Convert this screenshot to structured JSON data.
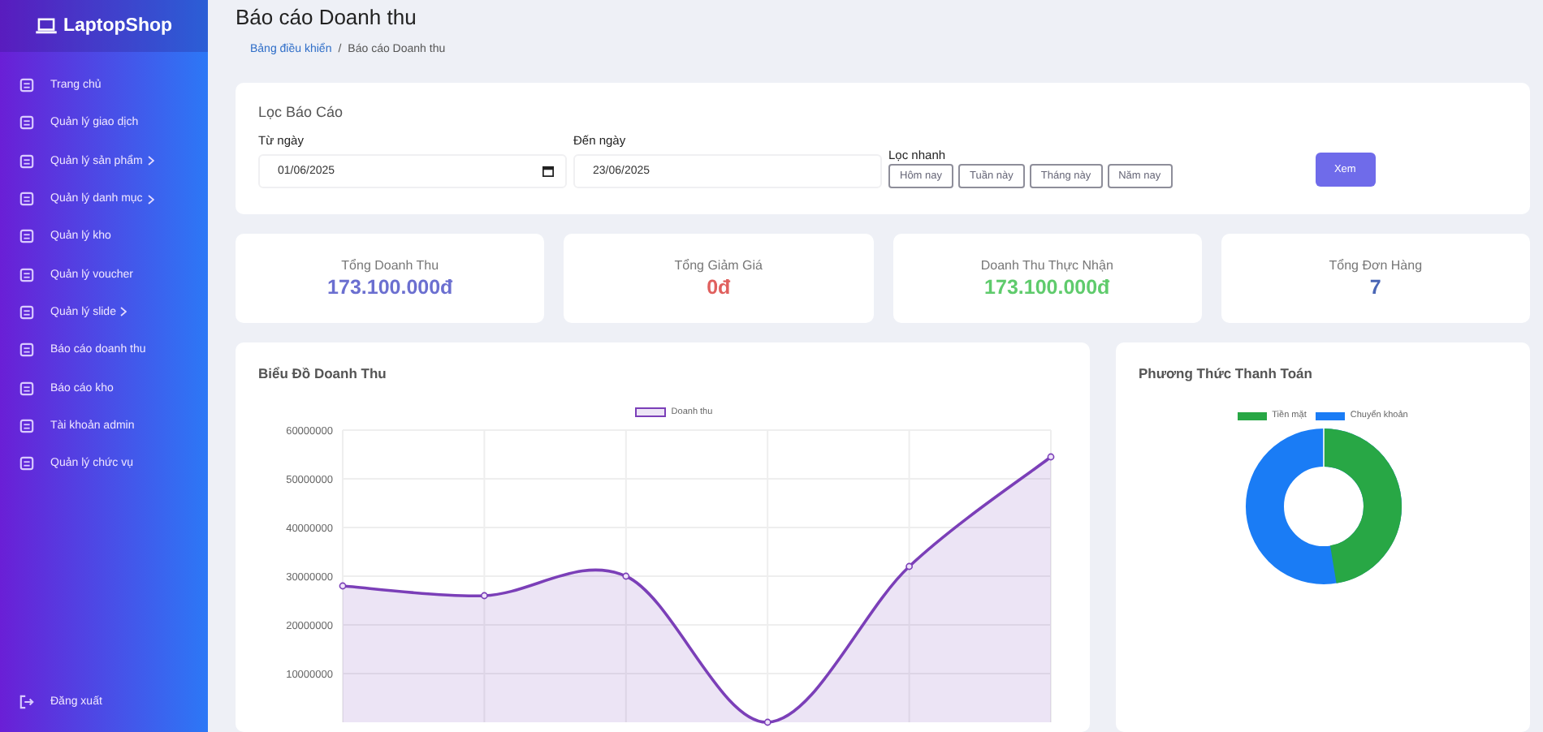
{
  "sidebar": {
    "logo": "LaptopShop",
    "items": [
      {
        "label": "Trang chủ",
        "expandable": false
      },
      {
        "label": "Quản lý giao dịch",
        "expandable": false
      },
      {
        "label": "Quản lý sản phẩm",
        "expandable": true
      },
      {
        "label": "Quản lý danh mục",
        "expandable": true
      },
      {
        "label": "Quản lý kho",
        "expandable": false
      },
      {
        "label": "Quản lý voucher",
        "expandable": false
      },
      {
        "label": "Quản lý slide",
        "expandable": true
      },
      {
        "label": "Báo cáo doanh thu",
        "expandable": false
      },
      {
        "label": "Báo cáo kho",
        "expandable": false
      },
      {
        "label": "Tài khoản admin",
        "expandable": false
      },
      {
        "label": "Quản lý chức vụ",
        "expandable": false
      }
    ],
    "logout": "Đăng xuất"
  },
  "page_title": "Báo cáo Doanh thu",
  "breadcrumb_separator": "/",
  "breadcrumb": [
    {
      "label": "Bảng điều khiển",
      "link": true
    },
    {
      "label": "Báo cáo Doanh thu",
      "link": false
    }
  ],
  "filter": {
    "title": "Lọc Báo Cáo",
    "fields": [
      {
        "label": "Từ ngày",
        "value": "01/06/2025",
        "calendar_icon": true
      },
      {
        "label": "Đến ngày",
        "value": "23/06/2025",
        "calendar_icon": false
      }
    ],
    "quick_label": "Lọc nhanh",
    "quick_buttons": [
      "Hôm nay",
      "Tuần này",
      "Tháng này",
      "Năm nay"
    ],
    "submit": "Xem"
  },
  "stats": [
    {
      "label": "Tổng Doanh Thu",
      "value": "173.100.000đ",
      "color": "#6b6fd0"
    },
    {
      "label": "Tổng Giảm Giá",
      "value": "0đ",
      "color": "#e0605e"
    },
    {
      "label": "Doanh Thu Thực Nhận",
      "value": "173.100.000đ",
      "color": "#5fcb6c"
    },
    {
      "label": "Tổng Đơn Hàng",
      "value": "7",
      "color": "#4a66b5"
    }
  ],
  "revenue_chart": {
    "title": "Biểu Đồ Doanh Thu",
    "chart_data": {
      "type": "area",
      "series": [
        {
          "name": "Doanh thu",
          "color": "#7b3fb8",
          "values": [
            28000000,
            26000000,
            30000000,
            0,
            32000000,
            54500000
          ]
        }
      ],
      "ylim": [
        0,
        60000000
      ],
      "grid": true,
      "yticks": [
        {
          "value": 10000000,
          "label": "10000000"
        },
        {
          "value": 20000000,
          "label": "20000000"
        },
        {
          "value": 30000000,
          "label": "30000000"
        },
        {
          "value": 40000000,
          "label": "40000000"
        },
        {
          "value": 50000000,
          "label": "50000000"
        },
        {
          "value": 60000000,
          "label": "60000000"
        }
      ]
    }
  },
  "payment_chart": {
    "title": "Phương Thức Thanh Toán",
    "legend": [
      {
        "label": "Tiền mặt",
        "color": "#28a745"
      },
      {
        "label": "Chuyển khoản",
        "color": "#1a7cf5"
      }
    ]
  }
}
